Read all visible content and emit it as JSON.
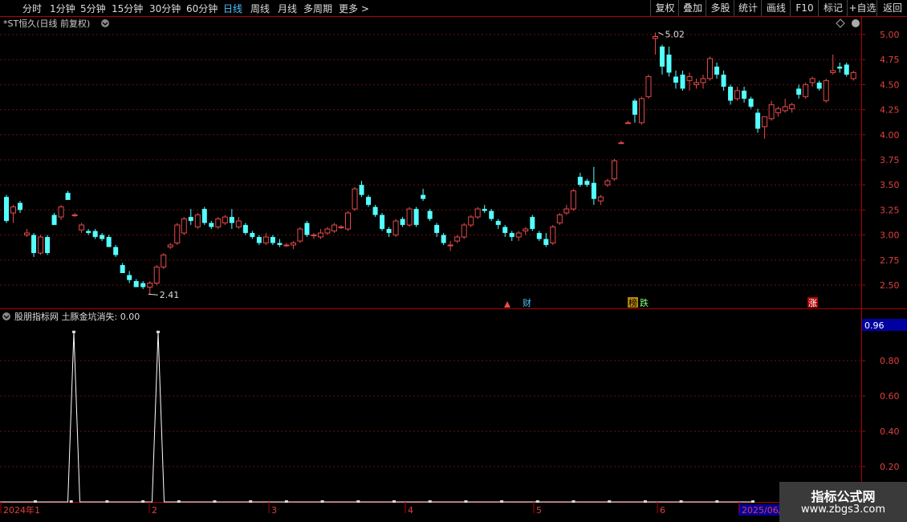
{
  "toolbar": {
    "timeframes": [
      "分时",
      "1分钟",
      "5分钟",
      "15分钟",
      "30分钟",
      "60分钟",
      "日线",
      "周线",
      "月线",
      "多周期",
      "更多 >"
    ],
    "active": "日线",
    "right_buttons": [
      "复权",
      "叠加",
      "多股",
      "统计",
      "画线",
      "F10",
      "标记",
      "+自选",
      "返回"
    ]
  },
  "main_chart": {
    "title": "*ST恒久(日线 前复权)",
    "y_ticks": [
      "5.00",
      "4.75",
      "4.50",
      "4.25",
      "4.00",
      "3.75",
      "3.50",
      "3.25",
      "3.00",
      "2.75",
      "2.50"
    ],
    "high_label": "5.02",
    "low_label": "2.41",
    "markers": [
      "财",
      "榜",
      "跌",
      "涨"
    ]
  },
  "indicator": {
    "title": "股朋指标网 土豚金坑消失: 0.00",
    "value_box": "0.96",
    "y_ticks": [
      "0.80",
      "0.60",
      "0.40",
      "0.20"
    ]
  },
  "x_axis": {
    "labels": [
      "2024年1",
      "2",
      "3",
      "4",
      "5",
      "6",
      "2025/06/"
    ]
  },
  "watermark": {
    "line1": "指标公式网",
    "line2": "www.zbgs3.com"
  },
  "colors": {
    "up": "#e84a4a",
    "down": "#54ffff",
    "grid": "#6b1010",
    "border": "#b00000",
    "axis_text": "#e04040",
    "indicator_line": "#ffffff",
    "value_box_bg": "#0000a0"
  },
  "chart_data": {
    "type": "candlestick",
    "ylim": [
      2.4,
      5.1
    ],
    "ohlc": [
      [
        3.38,
        3.4,
        3.12,
        3.14
      ],
      [
        3.22,
        3.3,
        3.12,
        3.28
      ],
      [
        3.32,
        3.34,
        3.22,
        3.25
      ],
      [
        3.0,
        3.06,
        2.98,
        3.02
      ],
      [
        3.0,
        3.02,
        2.78,
        2.82
      ],
      [
        2.82,
        3.0,
        2.8,
        2.98
      ],
      [
        2.98,
        3.0,
        2.8,
        2.82
      ],
      [
        3.2,
        3.22,
        3.1,
        3.1
      ],
      [
        3.18,
        3.3,
        3.15,
        3.28
      ],
      [
        3.42,
        3.44,
        3.35,
        3.35
      ],
      [
        3.2,
        3.22,
        3.18,
        3.2
      ],
      [
        3.05,
        3.12,
        3.02,
        3.1
      ],
      [
        3.04,
        3.06,
        3.0,
        3.02
      ],
      [
        3.04,
        3.06,
        2.96,
        2.98
      ],
      [
        3.0,
        3.02,
        2.94,
        2.96
      ],
      [
        2.98,
        3.0,
        2.88,
        2.88
      ],
      [
        2.88,
        2.9,
        2.78,
        2.8
      ],
      [
        2.7,
        2.72,
        2.62,
        2.62
      ],
      [
        2.6,
        2.64,
        2.52,
        2.55
      ],
      [
        2.54,
        2.56,
        2.48,
        2.48
      ],
      [
        2.52,
        2.54,
        2.46,
        2.48
      ],
      [
        2.48,
        2.54,
        2.41,
        2.52
      ],
      [
        2.52,
        2.7,
        2.5,
        2.68
      ],
      [
        2.68,
        2.82,
        2.66,
        2.8
      ],
      [
        2.88,
        2.92,
        2.86,
        2.9
      ],
      [
        2.92,
        3.12,
        2.9,
        3.1
      ],
      [
        3.02,
        3.18,
        3.0,
        3.16
      ],
      [
        3.18,
        3.26,
        3.1,
        3.14
      ],
      [
        3.08,
        3.22,
        3.06,
        3.2
      ],
      [
        3.26,
        3.28,
        3.1,
        3.12
      ],
      [
        3.12,
        3.14,
        3.06,
        3.08
      ],
      [
        3.08,
        3.18,
        3.06,
        3.16
      ],
      [
        3.12,
        3.2,
        3.1,
        3.18
      ],
      [
        3.18,
        3.26,
        3.06,
        3.12
      ],
      [
        3.08,
        3.18,
        3.06,
        3.14
      ],
      [
        3.1,
        3.12,
        3.0,
        3.02
      ],
      [
        3.02,
        3.04,
        2.96,
        2.98
      ],
      [
        2.98,
        3.0,
        2.9,
        2.92
      ],
      [
        2.92,
        3.02,
        2.9,
        2.98
      ],
      [
        2.98,
        3.0,
        2.9,
        2.92
      ],
      [
        2.92,
        2.96,
        2.88,
        2.9
      ],
      [
        2.9,
        2.92,
        2.88,
        2.9
      ],
      [
        2.9,
        2.94,
        2.86,
        2.92
      ],
      [
        2.94,
        3.08,
        2.92,
        3.06
      ],
      [
        3.12,
        3.14,
        2.98,
        3.0
      ],
      [
        3.0,
        3.02,
        2.96,
        3.0
      ],
      [
        2.98,
        3.06,
        2.96,
        3.02
      ],
      [
        3.02,
        3.08,
        3.0,
        3.06
      ],
      [
        3.04,
        3.12,
        3.02,
        3.1
      ],
      [
        3.08,
        3.1,
        3.06,
        3.08
      ],
      [
        3.06,
        3.24,
        3.04,
        3.22
      ],
      [
        3.26,
        3.48,
        3.24,
        3.46
      ],
      [
        3.5,
        3.54,
        3.38,
        3.4
      ],
      [
        3.38,
        3.4,
        3.28,
        3.3
      ],
      [
        3.28,
        3.3,
        3.18,
        3.2
      ],
      [
        3.2,
        3.22,
        3.04,
        3.06
      ],
      [
        3.06,
        3.08,
        2.98,
        3.02
      ],
      [
        3.0,
        3.16,
        2.98,
        3.14
      ],
      [
        3.16,
        3.18,
        3.08,
        3.1
      ],
      [
        3.1,
        3.28,
        3.08,
        3.26
      ],
      [
        3.26,
        3.28,
        3.08,
        3.1
      ],
      [
        3.4,
        3.46,
        3.34,
        3.36
      ],
      [
        3.24,
        3.26,
        3.14,
        3.16
      ],
      [
        3.1,
        3.12,
        2.98,
        3.02
      ],
      [
        3.0,
        3.02,
        2.9,
        2.92
      ],
      [
        2.9,
        2.94,
        2.84,
        2.9
      ],
      [
        2.94,
        3.0,
        2.92,
        2.98
      ],
      [
        2.98,
        3.12,
        2.96,
        3.1
      ],
      [
        3.1,
        3.2,
        3.08,
        3.18
      ],
      [
        3.18,
        3.28,
        3.16,
        3.26
      ],
      [
        3.26,
        3.3,
        3.22,
        3.24
      ],
      [
        3.24,
        3.26,
        3.14,
        3.16
      ],
      [
        3.14,
        3.16,
        3.06,
        3.1
      ],
      [
        3.08,
        3.1,
        2.98,
        3.02
      ],
      [
        3.02,
        3.04,
        2.94,
        2.98
      ],
      [
        2.98,
        3.04,
        2.94,
        3.02
      ],
      [
        3.04,
        3.08,
        3.0,
        3.06
      ],
      [
        3.18,
        3.2,
        3.04,
        3.06
      ],
      [
        3.02,
        3.04,
        2.94,
        2.96
      ],
      [
        2.96,
        3.02,
        2.88,
        2.9
      ],
      [
        2.92,
        3.1,
        2.9,
        3.08
      ],
      [
        3.12,
        3.22,
        3.1,
        3.2
      ],
      [
        3.22,
        3.3,
        3.2,
        3.26
      ],
      [
        3.26,
        3.46,
        3.24,
        3.44
      ],
      [
        3.58,
        3.62,
        3.48,
        3.5
      ],
      [
        3.54,
        3.56,
        3.48,
        3.5
      ],
      [
        3.52,
        3.68,
        3.3,
        3.36
      ],
      [
        3.34,
        3.4,
        3.3,
        3.38
      ],
      [
        3.5,
        3.56,
        3.48,
        3.54
      ],
      [
        3.56,
        3.76,
        3.54,
        3.74
      ],
      [
        3.92,
        3.94,
        3.92,
        3.92
      ],
      [
        4.12,
        4.14,
        4.12,
        4.12
      ],
      [
        4.34,
        4.36,
        4.12,
        4.2
      ],
      [
        4.12,
        4.38,
        4.1,
        4.36
      ],
      [
        4.38,
        4.6,
        4.36,
        4.58
      ],
      [
        4.96,
        5.02,
        4.8,
        4.98
      ],
      [
        4.88,
        4.9,
        4.6,
        4.68
      ],
      [
        4.8,
        4.88,
        4.58,
        4.62
      ],
      [
        4.58,
        4.64,
        4.46,
        4.52
      ],
      [
        4.6,
        4.64,
        4.44,
        4.46
      ],
      [
        4.54,
        4.62,
        4.44,
        4.58
      ],
      [
        4.5,
        4.56,
        4.46,
        4.52
      ],
      [
        4.52,
        4.6,
        4.46,
        4.56
      ],
      [
        4.56,
        4.78,
        4.54,
        4.76
      ],
      [
        4.68,
        4.72,
        4.56,
        4.6
      ],
      [
        4.6,
        4.64,
        4.44,
        4.48
      ],
      [
        4.48,
        4.5,
        4.3,
        4.34
      ],
      [
        4.36,
        4.48,
        4.34,
        4.44
      ],
      [
        4.44,
        4.48,
        4.32,
        4.36
      ],
      [
        4.36,
        4.38,
        4.26,
        4.28
      ],
      [
        4.22,
        4.26,
        4.02,
        4.06
      ],
      [
        4.08,
        4.16,
        3.96,
        4.18
      ],
      [
        4.16,
        4.34,
        4.14,
        4.3
      ],
      [
        4.22,
        4.28,
        4.18,
        4.26
      ],
      [
        4.24,
        4.36,
        4.22,
        4.28
      ],
      [
        4.26,
        4.32,
        4.22,
        4.3
      ],
      [
        4.46,
        4.5,
        4.36,
        4.4
      ],
      [
        4.38,
        4.52,
        4.36,
        4.5
      ],
      [
        4.52,
        4.58,
        4.48,
        4.56
      ],
      [
        4.52,
        4.54,
        4.44,
        4.46
      ],
      [
        4.34,
        4.56,
        4.32,
        4.54
      ],
      [
        4.62,
        4.8,
        4.6,
        4.64
      ],
      [
        4.68,
        4.72,
        4.62,
        4.66
      ],
      [
        4.7,
        4.72,
        4.58,
        4.6
      ],
      [
        4.56,
        4.64,
        4.54,
        4.62
      ]
    ],
    "indicator_values": [
      0,
      0,
      0,
      0,
      0,
      0,
      0,
      0,
      0,
      0,
      0,
      0,
      0,
      0,
      0,
      0,
      0,
      0,
      0,
      0,
      0,
      0,
      0,
      0,
      0,
      0,
      0,
      0,
      0,
      0,
      0,
      0,
      0,
      0,
      0,
      0,
      0,
      0,
      0,
      0,
      0,
      0,
      0,
      0,
      0,
      0,
      0,
      0,
      0,
      0,
      0,
      0,
      0,
      0,
      0,
      0,
      0,
      0,
      0,
      0,
      0,
      0,
      0,
      0,
      0,
      0,
      0,
      0,
      0,
      0,
      0,
      0,
      0,
      0,
      0,
      0,
      0,
      0,
      0,
      0,
      0,
      0,
      0,
      0,
      0,
      0,
      0,
      0,
      0,
      0,
      0,
      0,
      0,
      0,
      0,
      0,
      0,
      0,
      0,
      0,
      0,
      0,
      0,
      0,
      0,
      0,
      0,
      0,
      0,
      0,
      0,
      0,
      0,
      0,
      0,
      0,
      0,
      0,
      0,
      0,
      0,
      0,
      0,
      0,
      0
    ],
    "indicator_spikes": [
      {
        "index": 11,
        "value": 0.96
      },
      {
        "index": 25,
        "value": 0.96
      }
    ],
    "indicator_ylim": [
      0,
      1.0
    ]
  }
}
